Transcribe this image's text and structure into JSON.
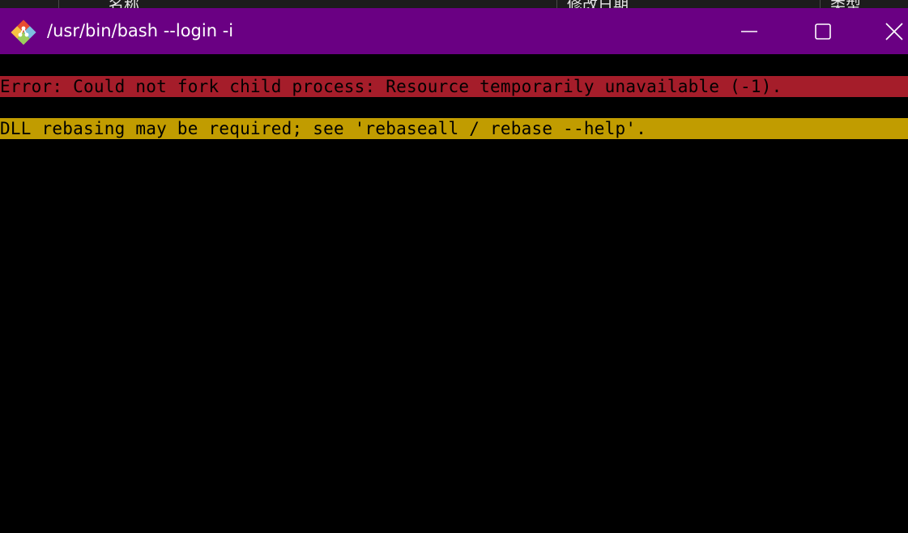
{
  "background_window": {
    "columns": [
      "名称",
      "修改日期",
      "类型"
    ]
  },
  "window": {
    "title": "/usr/bin/bash --login -i",
    "app_icon": "git-icon",
    "controls": {
      "minimize": "minimize-icon",
      "maximize": "maximize-icon",
      "close": "close-icon"
    },
    "colors": {
      "titlebar": "#6a0083",
      "terminal_bg": "#000000"
    }
  },
  "terminal": {
    "lines": [
      {
        "text": "Error: Could not fork child process: Resource temporarily unavailable (-1).",
        "highlight": "#a51d2a"
      },
      {
        "text": "DLL rebasing may be required; see 'rebaseall / rebase --help'.",
        "highlight": "#c19c00"
      }
    ]
  }
}
